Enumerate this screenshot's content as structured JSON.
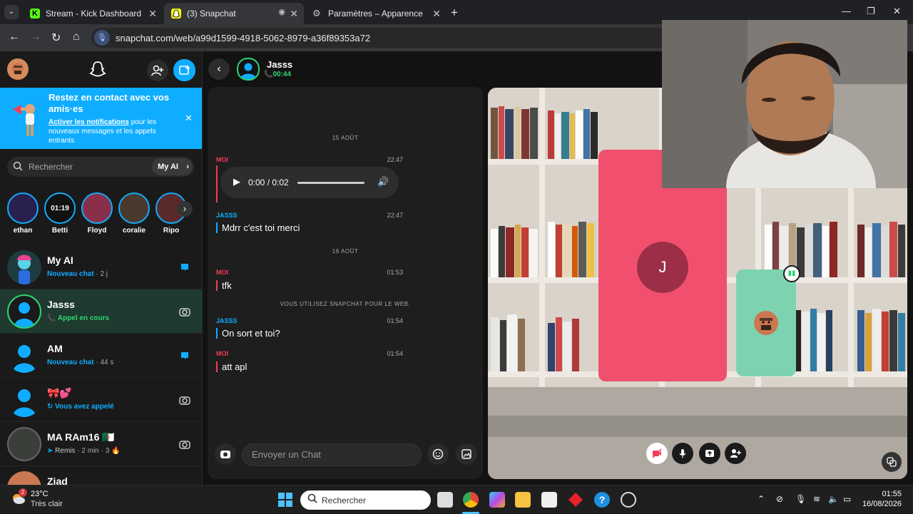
{
  "browser": {
    "tabs": [
      {
        "title": "Stream - Kick Dashboard",
        "favicon_color": "#53fc18",
        "favicon": "K"
      },
      {
        "title": "(3) Snapchat",
        "favicon_color": "#fffc00",
        "favicon": "ghost"
      },
      {
        "title": "Paramètres – Apparence",
        "favicon_color": "#9aa0a6",
        "favicon": "gear"
      }
    ],
    "url": "snapchat.com/web/a99d1599-4918-5062-8979-a36f89353a72"
  },
  "banner": {
    "title": "Restez en contact avec vos amis·es",
    "link": "Activer les notifications",
    "text": " pour les nouveaux messages et les appels entrants"
  },
  "search": {
    "placeholder": "Rechercher",
    "myai_label": "My AI"
  },
  "stories": [
    {
      "name": "ethan",
      "badge": ""
    },
    {
      "name": "Betti",
      "badge": "01:19"
    },
    {
      "name": "Floyd",
      "badge": ""
    },
    {
      "name": "coralie",
      "badge": ""
    },
    {
      "name": "Ripo",
      "badge": ""
    }
  ],
  "chats": [
    {
      "name": "My AI",
      "status": "Nouveau chat",
      "meta": "· 2 j",
      "type": "new"
    },
    {
      "name": "Jasss",
      "status": "Appel en cours",
      "meta": "",
      "type": "call"
    },
    {
      "name": "AM",
      "status": "Nouveau chat",
      "meta": "· 44 s",
      "type": "new"
    },
    {
      "name": "🎀💕",
      "status": "Vous avez appelé",
      "meta": "",
      "type": "called"
    },
    {
      "name": "MA RAm16 🇩🇿",
      "status": "Remis",
      "meta": "· 2 min · 3 🔥",
      "type": "sent"
    },
    {
      "name": "Ziad",
      "status": "",
      "meta": "",
      "type": "snap"
    }
  ],
  "chat_header": {
    "name": "Jasss",
    "call_time": "00:44"
  },
  "messages": {
    "day1": "15 AOÛT",
    "day2": "16 AOÛT",
    "notice": "VOUS UTILISEZ SNAPCHAT POUR LE WEB.",
    "items": [
      {
        "sender": "MOI",
        "time": "22:47",
        "text": ""
      },
      {
        "sender": "JASSS",
        "time": "22:47",
        "text": "Mdrr c'est toi merci"
      },
      {
        "sender": "MOI",
        "time": "01:53",
        "text": "tfk"
      },
      {
        "sender": "JASSS",
        "time": "01:54",
        "text": "On sort et toi?"
      },
      {
        "sender": "MOI",
        "time": "01:54",
        "text": "att apl"
      }
    ],
    "audio_time": "0:00 / 0:02",
    "composer_placeholder": "Envoyer un Chat"
  },
  "call": {
    "participant_initial": "J",
    "tile_color": "#f0506e",
    "self_tile_color": "#7dd3b0"
  },
  "taskbar": {
    "weather_temp": "23°C",
    "weather_text": "Très clair",
    "weather_badge": "2",
    "search_placeholder": "Rechercher",
    "time": "01:55",
    "date": "16/08/2026"
  }
}
